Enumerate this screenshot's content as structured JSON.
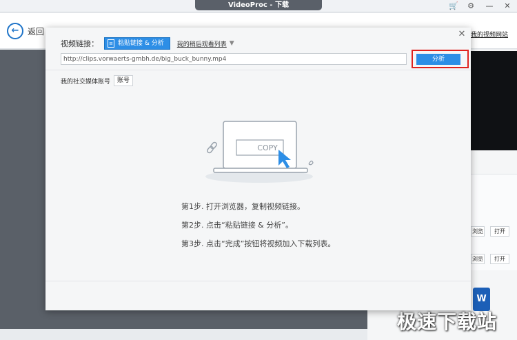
{
  "window": {
    "title": "VideoProc - 下载",
    "icons": [
      "cart-icon",
      "gear-icon",
      "minimize-icon",
      "close-icon"
    ]
  },
  "background": {
    "back_label": "返回",
    "right_link": "我的视频网站",
    "preview_label": "浏览",
    "open_label": "打开",
    "tile_glyph": "W",
    "watermark": "极速下载站"
  },
  "dialog": {
    "video_link_label": "视频链接：",
    "paste_button": "粘贴链接 & 分析",
    "watch_later_link": "我的稍后观看列表",
    "url_value": "http://clips.vorwaerts-gmbh.de/big_buck_bunny.mp4",
    "analyze_button": "分析",
    "social_label": "我的社交媒体账号",
    "account_button": "账号",
    "copy_label": "COPY",
    "steps": [
      "第1步. 打开浏览器，复制视频链接。",
      "第2步. 点击“粘贴链接 & 分析”。",
      "第3步. 点击“完成”按钮将视频加入下载列表。"
    ]
  },
  "colors": {
    "accent": "#2d8ee6",
    "highlight": "#e0211d",
    "title_pill": "#5a6069"
  }
}
